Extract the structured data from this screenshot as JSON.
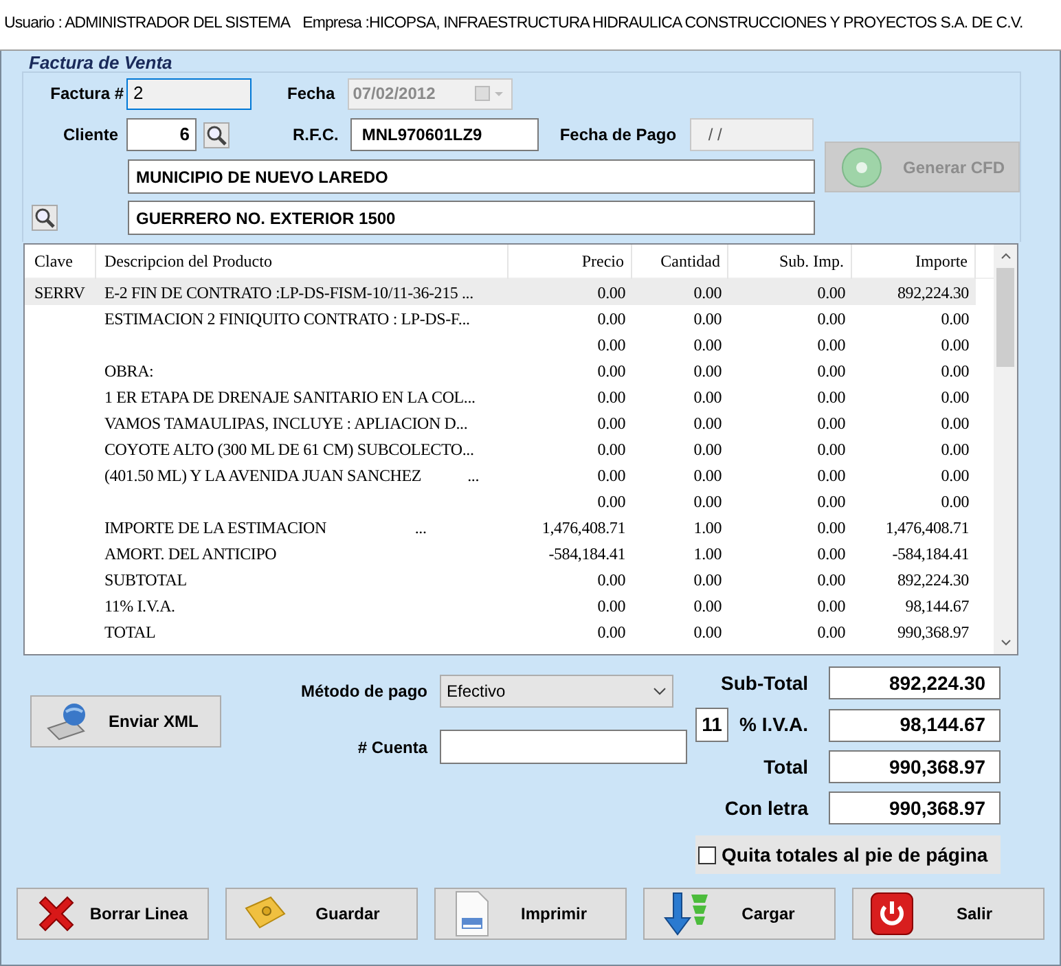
{
  "header": {
    "user": "Usuario : ADMINISTRADOR DEL SISTEMA",
    "company": "Empresa :HICOPSA, INFRAESTRUCTURA HIDRAULICA CONSTRUCCIONES Y PROYECTOS S.A. DE C.V."
  },
  "form": {
    "title": "Factura de Venta",
    "factura": {
      "label": "Factura #",
      "value": "2",
      "focused": true
    },
    "fecha": {
      "label": "Fecha",
      "value": "07/02/2012",
      "disabled": true
    },
    "cliente": {
      "label": "Cliente",
      "value": "6"
    },
    "rfc": {
      "label": "R.F.C.",
      "value": "MNL970601LZ9"
    },
    "fecha_pago": {
      "label": "Fecha de Pago",
      "value": " / /",
      "disabled": true
    },
    "cliente_nombre": "MUNICIPIO DE NUEVO LAREDO",
    "direccion": "GUERRERO NO. EXTERIOR 1500",
    "generar_cfd": {
      "label": "Generar CFD",
      "disabled": true
    }
  },
  "table": {
    "columns": [
      "Clave",
      "Descripcion del Producto",
      "Precio",
      "Cantidad",
      "Sub. Imp.",
      "Importe"
    ],
    "rows": [
      {
        "clave": "SERRV",
        "descripcion": "E-2 FIN DE CONTRATO :LP-DS-FISM-10/11-36-215 ...",
        "precio": "0.00",
        "cantidad": "0.00",
        "sub_imp": "0.00",
        "importe": "892,224.30",
        "selected": true
      },
      {
        "descripcion": "ESTIMACION 2 FINIQUITO CONTRATO : LP-DS-F...",
        "precio": "0.00",
        "cantidad": "0.00",
        "sub_imp": "0.00",
        "importe": "0.00",
        "selected": false
      },
      {
        "precio": "0.00",
        "cantidad": "0.00",
        "sub_imp": "0.00",
        "importe": "0.00",
        "selected": false
      },
      {
        "descripcion": "OBRA:",
        "precio": "0.00",
        "cantidad": "0.00",
        "sub_imp": "0.00",
        "importe": "0.00",
        "selected": false
      },
      {
        "descripcion": "1 ER ETAPA DE DRENAJE SANITARIO EN LA COL...",
        "precio": "0.00",
        "cantidad": "0.00",
        "sub_imp": "0.00",
        "importe": "0.00",
        "selected": false
      },
      {
        "descripcion": "VAMOS TAMAULIPAS, INCLUYE : APLIACION D...",
        "precio": "0.00",
        "cantidad": "0.00",
        "sub_imp": "0.00",
        "importe": "0.00",
        "selected": false
      },
      {
        "descripcion": "COYOTE ALTO (300 ML DE 61 CM) SUBCOLECTO...",
        "precio": "0.00",
        "cantidad": "0.00",
        "sub_imp": "0.00",
        "importe": "0.00",
        "selected": false
      },
      {
        "descripcion": "(401.50 ML) Y LA AVENIDA JUAN SANCHEZ            ...",
        "precio": "0.00",
        "cantidad": "0.00",
        "sub_imp": "0.00",
        "importe": "0.00",
        "selected": false
      },
      {
        "precio": "0.00",
        "cantidad": "0.00",
        "sub_imp": "0.00",
        "importe": "0.00",
        "selected": false
      },
      {
        "descripcion": "IMPORTE DE LA ESTIMACION                       ...",
        "precio": "1,476,408.71",
        "cantidad": "1.00",
        "sub_imp": "0.00",
        "importe": "1,476,408.71",
        "selected": false
      },
      {
        "descripcion": "AMORT. DEL ANTICIPO",
        "precio": "-584,184.41",
        "cantidad": "1.00",
        "sub_imp": "0.00",
        "importe": "-584,184.41",
        "selected": false
      },
      {
        "descripcion": "SUBTOTAL",
        "precio": "0.00",
        "cantidad": "0.00",
        "sub_imp": "0.00",
        "importe": "892,224.30",
        "selected": false
      },
      {
        "descripcion": "11% I.V.A.",
        "precio": "0.00",
        "cantidad": "0.00",
        "sub_imp": "0.00",
        "importe": "98,144.67",
        "selected": false
      },
      {
        "descripcion": "TOTAL",
        "precio": "0.00",
        "cantidad": "0.00",
        "sub_imp": "0.00",
        "importe": "990,368.97",
        "selected": false
      }
    ]
  },
  "payment": {
    "enviar_xml": "Enviar XML",
    "metodo_label": "Método de pago",
    "metodo_value": "Efectivo",
    "cuenta_label": "# Cuenta"
  },
  "totals": {
    "subtotal_label": "Sub-Total",
    "subtotal": "892,224.30",
    "iva_rate": "11",
    "iva_label": "% I.V.A.",
    "iva": "98,144.67",
    "total_label": "Total",
    "total": "990,368.97",
    "letra_label": "Con letra",
    "letra": "990,368.97"
  },
  "quita_totales": {
    "label": "Quita totales al pie de página",
    "checked": false
  },
  "buttons": [
    {
      "kind": "delete",
      "label": "Borrar Linea"
    },
    {
      "kind": "save",
      "label": "Guardar"
    },
    {
      "kind": "print",
      "label": "Imprimir"
    },
    {
      "kind": "load",
      "label": "Cargar"
    },
    {
      "kind": "exit",
      "label": "Salir"
    }
  ]
}
